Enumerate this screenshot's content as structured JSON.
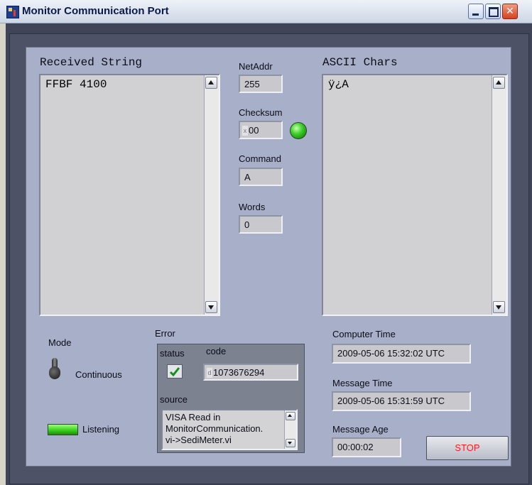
{
  "window": {
    "title": "Monitor Communication Port"
  },
  "received": {
    "label": "Received String",
    "value": "FFBF 4100"
  },
  "ascii": {
    "label": "ASCII Chars",
    "value": "ÿ¿A"
  },
  "netaddr": {
    "label": "NetAddr",
    "value": "255"
  },
  "checksum": {
    "label": "Checksum",
    "radix": "x",
    "value": "00"
  },
  "command": {
    "label": "Command",
    "value": "A"
  },
  "words": {
    "label": "Words",
    "value": "0"
  },
  "mode": {
    "label": "Mode",
    "state": "Continuous"
  },
  "listening": {
    "label": "Listening"
  },
  "error": {
    "label": "Error",
    "status_label": "status",
    "code_label": "code",
    "code_radix": "d",
    "code_value": "1073676294",
    "source_label": "source",
    "source_value": "VISA Read in\nMonitorCommunication.\nvi->SediMeter.vi"
  },
  "computer_time": {
    "label": "Computer Time",
    "value": "2009-05-06 15:32:02 UTC"
  },
  "message_time": {
    "label": "Message Time",
    "value": "2009-05-06 15:31:59 UTC"
  },
  "message_age": {
    "label": "Message Age",
    "value": "00:00:02"
  },
  "stop": {
    "label": "STOP"
  },
  "icons": {
    "app": "labview-app-icon",
    "minimize": "minimize-icon",
    "maximize": "maximize-icon",
    "close": "close-icon"
  },
  "colors": {
    "panel_bg": "#a7b0c8",
    "led_green": "#3fd22a",
    "stop_text": "#ff1a1a"
  }
}
